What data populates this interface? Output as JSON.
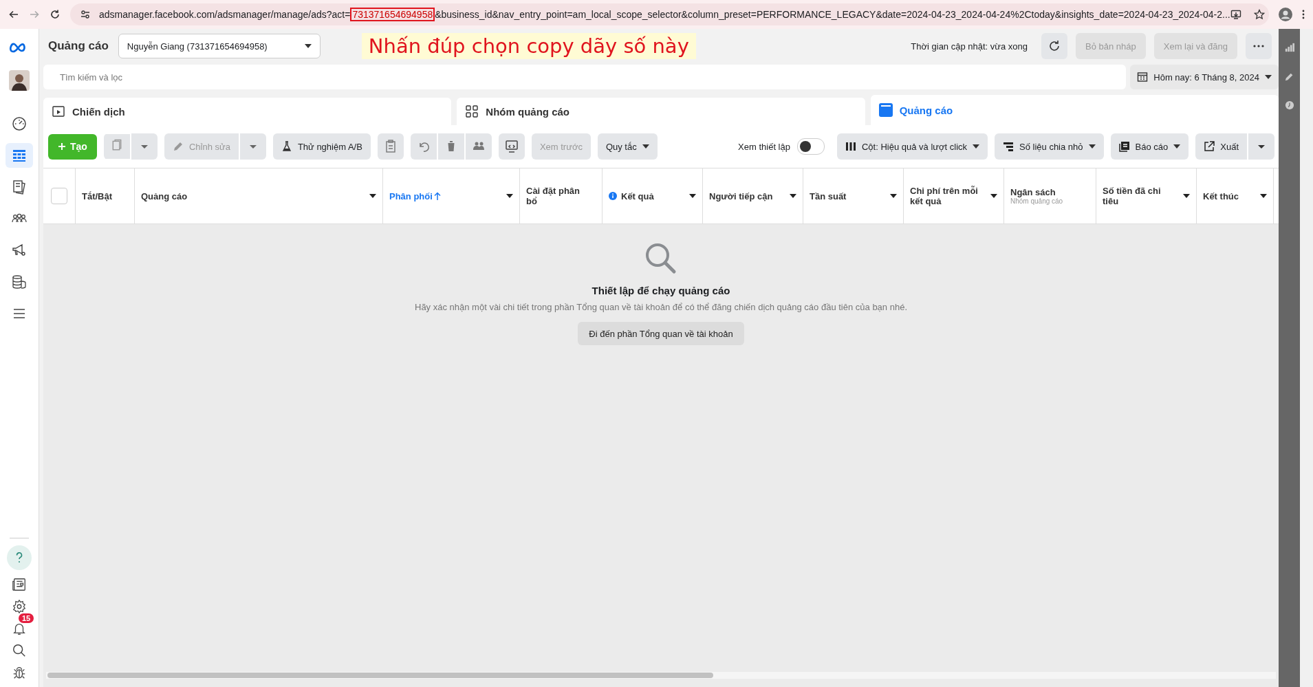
{
  "browser": {
    "url_before": "adsmanager.facebook.com/adsmanager/manage/ads?act=",
    "url_highlighted": "731371654694958",
    "url_after": "&business_id&nav_entry_point=am_local_scope_selector&column_preset=PERFORMANCE_LEGACY&date=2024-04-23_2024-04-24%2Ctoday&insights_date=2024-04-23_2024-04-2..."
  },
  "annotation": {
    "text": "Nhấn đúp chọn copy dãy số này"
  },
  "nav": {
    "items": [
      {
        "selected": false
      },
      {
        "selected": true
      },
      {
        "selected": false
      },
      {
        "selected": false
      },
      {
        "selected": false
      },
      {
        "selected": false
      },
      {
        "selected": false
      }
    ],
    "notification_badge": "15"
  },
  "header": {
    "title": "Quảng cáo",
    "account": "Nguyễn Giang (731371654694958)",
    "update_status": "Thời gian cập nhật: vừa xong",
    "buttons": [
      {
        "label": "Bỏ bản nháp",
        "disabled": true
      },
      {
        "label": "Xem lại và đăng",
        "disabled": true
      }
    ]
  },
  "search": {
    "placeholder": "Tìm kiếm và lọc"
  },
  "date_range": "Hôm nay: 6 Tháng 8, 2024",
  "tabs": [
    {
      "label": "Chiến dịch",
      "selected": false
    },
    {
      "label": "Nhóm quảng cáo",
      "selected": false
    },
    {
      "label": "Quảng cáo",
      "selected": true
    }
  ],
  "toolbar": {
    "create": "Tạo",
    "edit": {
      "label": "Chỉnh sửa",
      "disabled": true
    },
    "ab_test": {
      "label": "Thử nghiệm A/B",
      "disabled": false
    },
    "preview": {
      "label": "Xem trước",
      "disabled": true
    },
    "rules": "Quy tắc",
    "setup_view": {
      "label": "Xem thiết lập",
      "on": false
    },
    "columns": "Cột: Hiệu quả và lượt click",
    "breakdown": "Số liệu chia nhỏ",
    "reports": "Báo cáo",
    "export": "Xuất"
  },
  "table": {
    "select_all_checked": false,
    "columns": [
      {
        "label": "Tắt/Bật",
        "dropdown": false,
        "sorted": false,
        "info": false
      },
      {
        "label": "Quảng cáo",
        "dropdown": true,
        "sorted": false,
        "info": false
      },
      {
        "label": "Phân phối",
        "dropdown": true,
        "sorted": true,
        "info": false
      },
      {
        "label": "Cài đặt phân bổ",
        "dropdown": false,
        "sorted": false,
        "info": false
      },
      {
        "label": "Kết quả",
        "dropdown": true,
        "sorted": false,
        "info": true
      },
      {
        "label": "Người tiếp cận",
        "dropdown": true,
        "sorted": false,
        "info": false
      },
      {
        "label": "Tần suất",
        "dropdown": true,
        "sorted": false,
        "info": false
      },
      {
        "label": "Chi phí trên mỗi kết quả",
        "dropdown": true,
        "sorted": false,
        "info": false
      },
      {
        "label": "Ngân sách",
        "sublabel": "Nhóm quảng cáo",
        "dropdown": false,
        "sorted": false,
        "info": false
      },
      {
        "label": "Số tiền đã chi tiêu",
        "dropdown": true,
        "sorted": false,
        "info": false
      },
      {
        "label": "Kết thúc",
        "dropdown": true,
        "sorted": false,
        "info": false
      }
    ]
  },
  "empty_state": {
    "title": "Thiết lập để chạy quảng cáo",
    "message": "Hãy xác nhận một vài chi tiết trong phần Tổng quan về tài khoản để có thể đăng chiến dịch quảng cáo đầu tiên của bạn nhé.",
    "button": "Đi đến phần Tổng quan về tài khoản"
  }
}
